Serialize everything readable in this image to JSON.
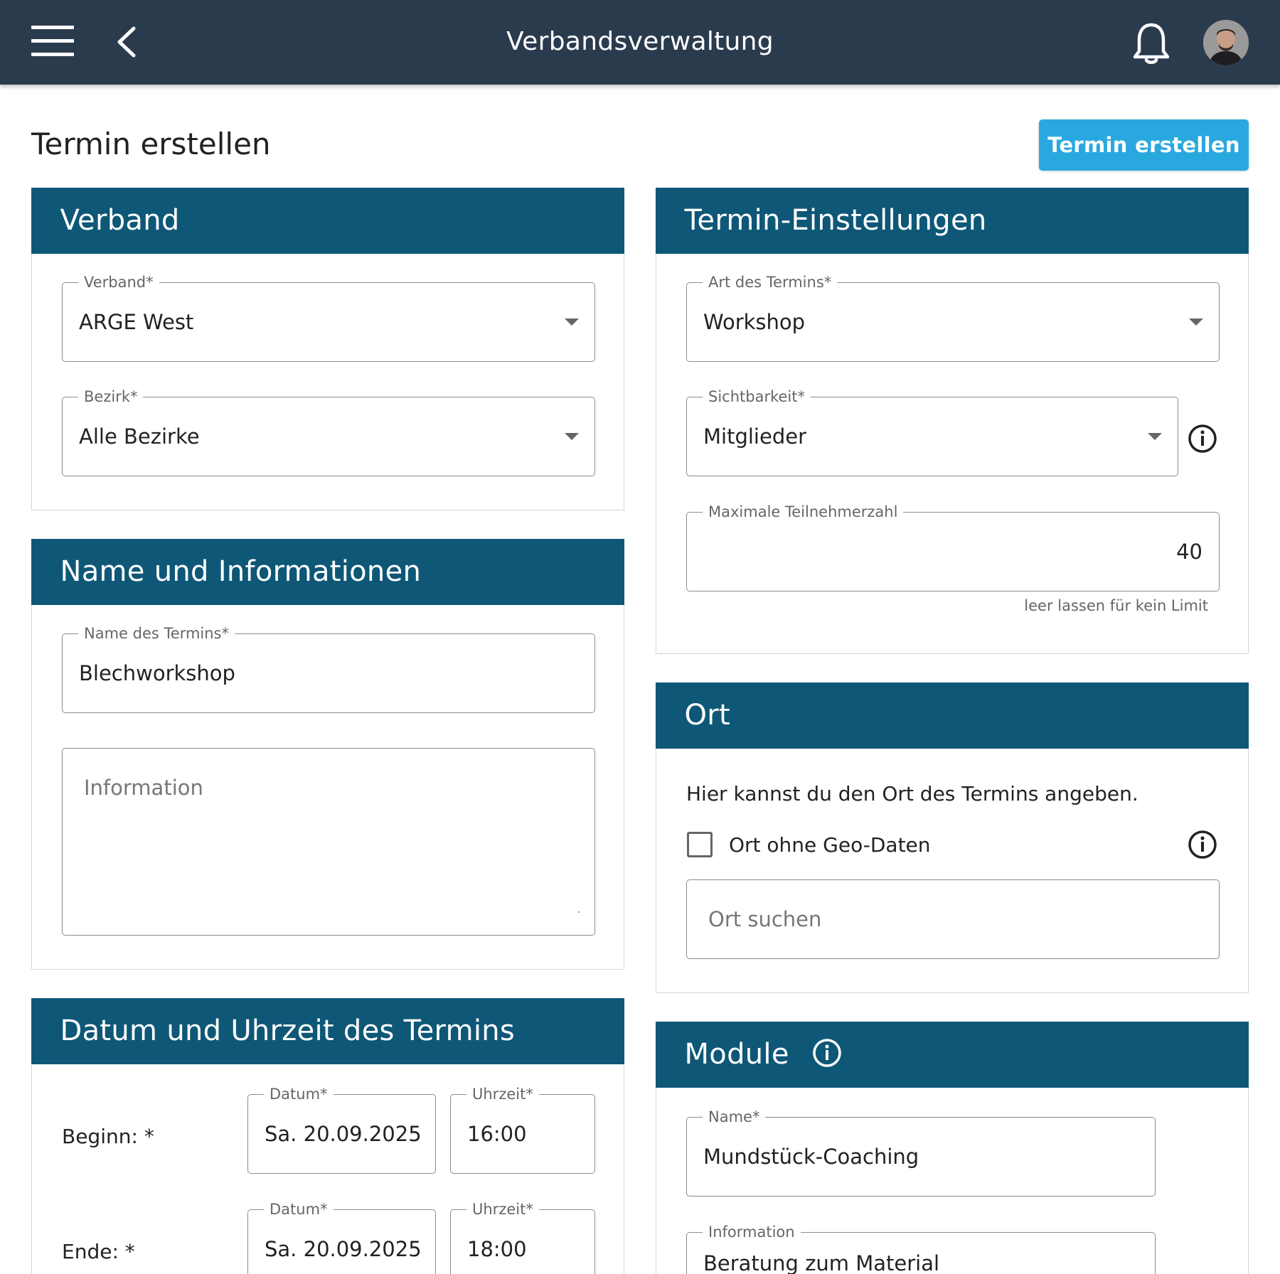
{
  "appbar": {
    "title": "Verbandsverwaltung"
  },
  "page": {
    "title": "Termin erstellen",
    "submit_label": "Termin erstellen"
  },
  "verband_card": {
    "title": "Verband",
    "verband": {
      "label": "Verband*",
      "value": "ARGE West"
    },
    "bezirk": {
      "label": "Bezirk*",
      "value": "Alle Bezirke"
    }
  },
  "name_card": {
    "title": "Name und Informationen",
    "name": {
      "label": "Name des Termins*",
      "value": "Blechworkshop"
    },
    "information": {
      "placeholder": "Information",
      "value": ""
    }
  },
  "datetime_card": {
    "title": "Datum und Uhrzeit des Termins",
    "begin": {
      "label": "Beginn: *",
      "date_label": "Datum*",
      "date_value": "Sa. 20.09.2025",
      "time_label": "Uhrzeit*",
      "time_value": "16:00"
    },
    "end": {
      "label": "Ende: *",
      "date_label": "Datum*",
      "date_value": "Sa. 20.09.2025",
      "time_label": "Uhrzeit*",
      "time_value": "18:00"
    }
  },
  "settings_card": {
    "title": "Termin-Einstellungen",
    "art": {
      "label": "Art des Termins*",
      "value": "Workshop"
    },
    "sichtbarkeit": {
      "label": "Sichtbarkeit*",
      "value": "Mitglieder"
    },
    "max_teilnehmer": {
      "label": "Maximale Teilnehmerzahl",
      "value": "40",
      "hint": "leer lassen für kein Limit"
    }
  },
  "ort_card": {
    "title": "Ort",
    "description": "Hier kannst du den Ort des Termins angeben.",
    "checkbox_label": "Ort ohne Geo-Daten",
    "checkbox_checked": false,
    "search_placeholder": "Ort suchen"
  },
  "module_card": {
    "title": "Module",
    "name": {
      "label": "Name*",
      "value": "Mundstück-Coaching"
    },
    "information": {
      "label": "Information",
      "value": "Beratung zum Material"
    }
  },
  "colors": {
    "appbar": "#2b3b4e",
    "card_header": "#0e5777",
    "primary": "#29a8e0"
  }
}
